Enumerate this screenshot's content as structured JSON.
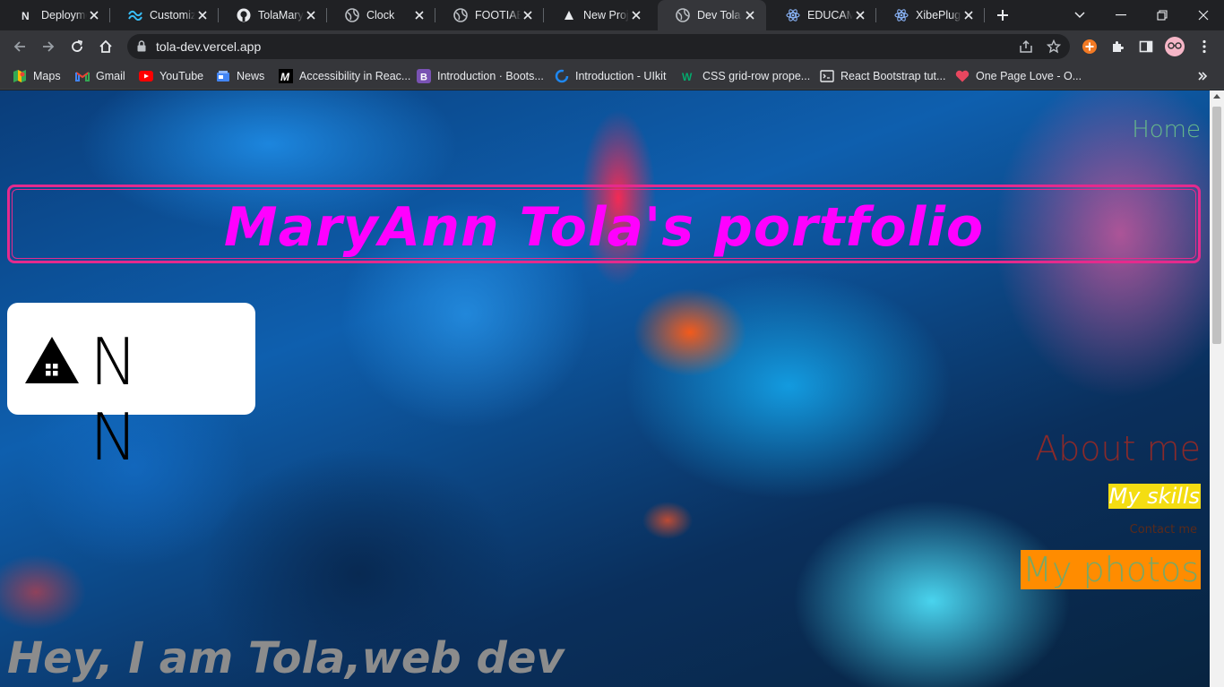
{
  "browser": {
    "tabs": [
      {
        "title": "Deploymen",
        "icon": "nextjs-icon",
        "active": false
      },
      {
        "title": "Customizin",
        "icon": "tailwind-icon",
        "active": false
      },
      {
        "title": "TolaMaryA",
        "icon": "github-icon",
        "active": false
      },
      {
        "title": "Clock",
        "icon": "globe-icon",
        "active": false
      },
      {
        "title": "FOOTIAE",
        "icon": "globe-icon",
        "active": false
      },
      {
        "title": "New Projec",
        "icon": "vercel-icon",
        "active": false
      },
      {
        "title": "Dev Tola p",
        "icon": "globe-icon",
        "active": true
      },
      {
        "title": "EDUCAMIA",
        "icon": "react-icon",
        "active": false
      },
      {
        "title": "XibePlug",
        "icon": "react-icon",
        "active": false
      }
    ],
    "url": "tola-dev.vercel.app",
    "bookmarks": [
      {
        "label": "Maps",
        "icon": "maps-icon"
      },
      {
        "label": "Gmail",
        "icon": "gmail-icon"
      },
      {
        "label": "YouTube",
        "icon": "youtube-icon"
      },
      {
        "label": "News",
        "icon": "news-icon"
      },
      {
        "label": "Accessibility in Reac...",
        "icon": "mdn-icon"
      },
      {
        "label": "Introduction · Boots...",
        "icon": "bootstrap-icon"
      },
      {
        "label": "Introduction - UIkit",
        "icon": "uikit-icon"
      },
      {
        "label": "CSS grid-row prope...",
        "icon": "w3schools-icon"
      },
      {
        "label": "React Bootstrap tut...",
        "icon": "tutorial-icon"
      },
      {
        "label": "One Page Love - O...",
        "icon": "heart-icon"
      }
    ]
  },
  "page": {
    "nav_home": "Home",
    "banner_title": "MaryAnn Tola's portfolio",
    "logo_text": "N N",
    "nav_about": "About me",
    "nav_skills": "My skills",
    "nav_contact": "Contact me",
    "nav_photos": "My photos",
    "hero_text": "Hey, I am Tola,web dev"
  },
  "colors": {
    "banner_title": "#ff00ff",
    "banner_border": "#e52a8d",
    "home_link": "#67b98a",
    "about_link": "#8a2a2a",
    "skills_bg": "#f4dd12",
    "photos_bg": "#ff8c00",
    "photos_text": "#79a766",
    "hero_text": "#8c8c8c"
  }
}
